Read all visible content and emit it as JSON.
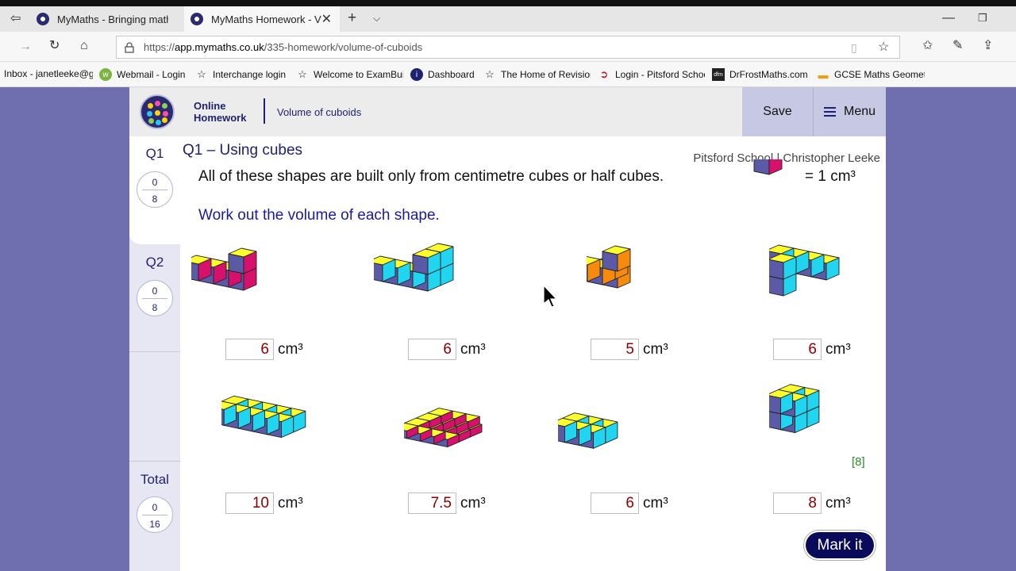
{
  "browser": {
    "tabs": [
      {
        "title": "MyMaths - Bringing maths a",
        "active": false
      },
      {
        "title": "MyMaths Homework - V",
        "active": true
      }
    ],
    "url": {
      "prefix": "https://",
      "host": "app.mymaths.co.uk",
      "path": "/335-homework/volume-of-cuboids"
    },
    "bookmarks": [
      "Inbox - janetleeke@g",
      "Webmail - Login",
      "Interchange login",
      "Welcome to ExamBui",
      "Dashboard",
      "The Home of Revisior",
      "Login - Pitsford Schoo",
      "DrFrostMaths.com",
      "GCSE Maths Geometr"
    ]
  },
  "header": {
    "brand_line1": "Online",
    "brand_line2": "Homework",
    "title": "Volume of cuboids",
    "save_label": "Save",
    "menu_label": "Menu"
  },
  "sidebar": {
    "questions": [
      {
        "label": "Q1",
        "score": "0",
        "max": "8"
      },
      {
        "label": "Q2",
        "score": "0",
        "max": "8"
      }
    ],
    "total": {
      "label": "Total",
      "score": "0",
      "max": "16"
    }
  },
  "question": {
    "title": "Q1 – Using cubes",
    "school": "Pitsford School | Christopher Leeke",
    "instruction": "All of these shapes are built only from centimetre cubes or half cubes.",
    "unit_equation": "= 1 cm³",
    "task": "Work out the volume of each shape.",
    "answers": [
      "6",
      "6",
      "5",
      "6",
      "10",
      "7.5",
      "6",
      "8"
    ],
    "unit": "cm³",
    "marks": "[8]",
    "mark_button": "Mark it"
  },
  "colors": {
    "top": "#ffff2e",
    "left_face": "#5a5aa6",
    "magenta": "#d6116b",
    "cyan": "#21d4f0",
    "orange": "#f58a0b",
    "navy": "#1f2270",
    "page_bg": "#6f6fb0"
  }
}
